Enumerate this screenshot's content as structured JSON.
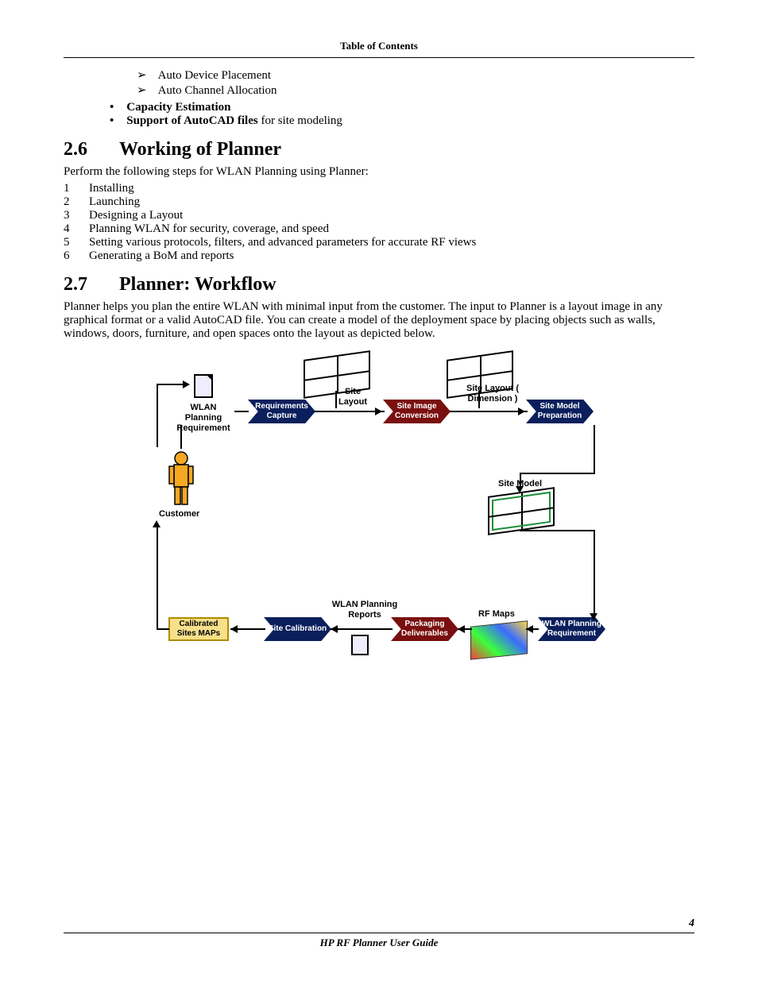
{
  "header": "Table of Contents",
  "arrow_items": [
    "Auto Device Placement",
    "Auto Channel Allocation"
  ],
  "disc_items": [
    {
      "bold": "Capacity Estimation",
      "rest": ""
    },
    {
      "bold": "Support of AutoCAD files",
      "rest": " for site modeling"
    }
  ],
  "section26": {
    "num": "2.6",
    "title": "Working of Planner"
  },
  "intro26": "Perform the following steps for WLAN Planning using Planner:",
  "steps": [
    "Installing",
    "Launching",
    "Designing a Layout",
    "Planning WLAN for security, coverage, and speed",
    "Setting various protocols, filters, and advanced parameters for accurate RF views",
    "Generating a BoM and reports"
  ],
  "section27": {
    "num": "2.7",
    "title": "Planner: Workflow"
  },
  "intro27": "Planner helps you plan the entire WLAN with minimal input from the customer. The input to Planner is a layout image in any graphical format or a valid AutoCAD file. You can create a model of the deployment space by placing objects such as walls, windows, doors, furniture, and open spaces onto the layout as depicted below.",
  "diagram": {
    "wlan_req": "WLAN Planning Requirement",
    "req_capture": "Requirements Capture",
    "site_layout": "Site Layout",
    "site_img": "Site Image Conversion",
    "site_layout_dim": "Site Layout ( Dimension )",
    "site_model_prep": "Site Model Preparation",
    "customer": "Customer",
    "site_model": "Site Model",
    "calibrated": "Calibrated Sites MAPs",
    "site_cal": "Site Calibration",
    "wlan_reports": "WLAN Planning Reports",
    "packaging": "Packaging Deliverables",
    "rf_maps": "RF Maps",
    "wlan_req2": "WLAN Planning Requirement"
  },
  "footer": "HP RF Planner User Guide",
  "page": "4"
}
